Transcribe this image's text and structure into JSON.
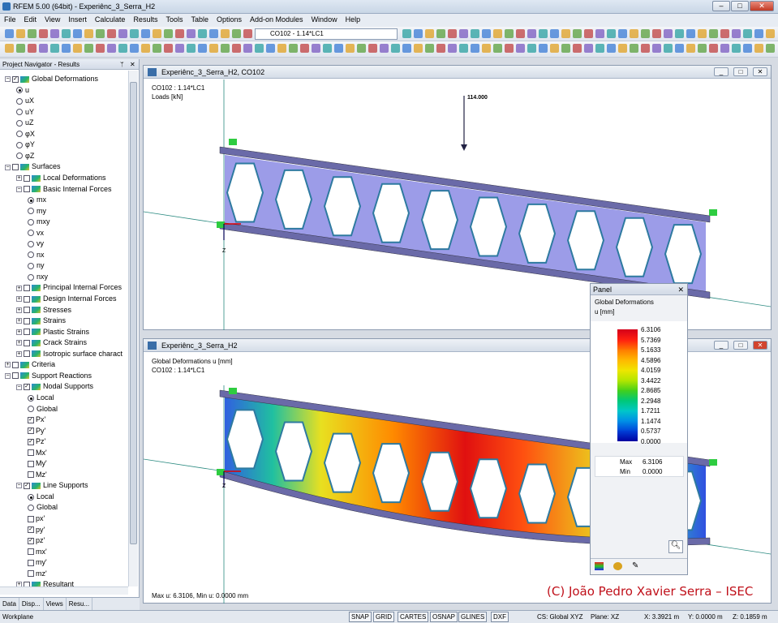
{
  "window": {
    "title": "RFEM 5.00 (64bit) - Experiênc_3_Serra_H2"
  },
  "menu": [
    "File",
    "Edit",
    "View",
    "Insert",
    "Calculate",
    "Results",
    "Tools",
    "Table",
    "Options",
    "Add-on Modules",
    "Window",
    "Help"
  ],
  "toolbar": {
    "load_combo": "CO102 - 1.14*LC1"
  },
  "navigator": {
    "title": "Project Navigator - Results",
    "items": [
      {
        "label": "Global Deformations",
        "level": 1,
        "kind": "folder-check"
      },
      {
        "label": "u",
        "level": 2,
        "kind": "radio",
        "on": true
      },
      {
        "label": "uX",
        "level": 2,
        "kind": "radio"
      },
      {
        "label": "uY",
        "level": 2,
        "kind": "radio"
      },
      {
        "label": "uZ",
        "level": 2,
        "kind": "radio"
      },
      {
        "label": "φX",
        "level": 2,
        "kind": "radio"
      },
      {
        "label": "φY",
        "level": 2,
        "kind": "radio"
      },
      {
        "label": "φZ",
        "level": 2,
        "kind": "radio"
      },
      {
        "label": "Surfaces",
        "level": 1,
        "kind": "folder-check"
      },
      {
        "label": "Local Deformations",
        "level": 2,
        "kind": "folder-check"
      },
      {
        "label": "Basic Internal Forces",
        "level": 2,
        "kind": "folder-check"
      },
      {
        "label": "mx",
        "level": 3,
        "kind": "radio",
        "on": true
      },
      {
        "label": "my",
        "level": 3,
        "kind": "radio"
      },
      {
        "label": "mxy",
        "level": 3,
        "kind": "radio"
      },
      {
        "label": "vx",
        "level": 3,
        "kind": "radio"
      },
      {
        "label": "vy",
        "level": 3,
        "kind": "radio"
      },
      {
        "label": "nx",
        "level": 3,
        "kind": "radio"
      },
      {
        "label": "ny",
        "level": 3,
        "kind": "radio"
      },
      {
        "label": "nxy",
        "level": 3,
        "kind": "radio"
      },
      {
        "label": "Principal Internal Forces",
        "level": 2,
        "kind": "folder-check"
      },
      {
        "label": "Design Internal Forces",
        "level": 2,
        "kind": "folder-check"
      },
      {
        "label": "Stresses",
        "level": 2,
        "kind": "folder-check"
      },
      {
        "label": "Strains",
        "level": 2,
        "kind": "folder-check"
      },
      {
        "label": "Plastic Strains",
        "level": 2,
        "kind": "folder-check"
      },
      {
        "label": "Crack Strains",
        "level": 2,
        "kind": "folder-check"
      },
      {
        "label": "Isotropic surface charact",
        "level": 2,
        "kind": "folder-check"
      },
      {
        "label": "Criteria",
        "level": 1,
        "kind": "folder-check"
      },
      {
        "label": "Support Reactions",
        "level": 1,
        "kind": "folder-check"
      },
      {
        "label": "Nodal Supports",
        "level": 2,
        "kind": "folder-check"
      },
      {
        "label": "Local",
        "level": 3,
        "kind": "radio",
        "on": true
      },
      {
        "label": "Global",
        "level": 3,
        "kind": "radio"
      },
      {
        "label": "Px'",
        "level": 3,
        "kind": "check",
        "on": true
      },
      {
        "label": "Py'",
        "level": 3,
        "kind": "check",
        "on": true
      },
      {
        "label": "Pz'",
        "level": 3,
        "kind": "check",
        "on": true
      },
      {
        "label": "Mx'",
        "level": 3,
        "kind": "check"
      },
      {
        "label": "My'",
        "level": 3,
        "kind": "check"
      },
      {
        "label": "Mz'",
        "level": 3,
        "kind": "check"
      },
      {
        "label": "Line Supports",
        "level": 2,
        "kind": "folder-check"
      },
      {
        "label": "Local",
        "level": 3,
        "kind": "radio",
        "on": true
      },
      {
        "label": "Global",
        "level": 3,
        "kind": "radio"
      },
      {
        "label": "px'",
        "level": 3,
        "kind": "check"
      },
      {
        "label": "py'",
        "level": 3,
        "kind": "check",
        "on": true
      },
      {
        "label": "pz'",
        "level": 3,
        "kind": "check",
        "on": true
      },
      {
        "label": "mx'",
        "level": 3,
        "kind": "check"
      },
      {
        "label": "my'",
        "level": 3,
        "kind": "check"
      },
      {
        "label": "mz'",
        "level": 3,
        "kind": "check"
      },
      {
        "label": "Resultant",
        "level": 2,
        "kind": "folder-check"
      }
    ],
    "tabs": [
      "Data",
      "Disp...",
      "Views",
      "Resu..."
    ]
  },
  "view1": {
    "title": "Experiênc_3_Serra_H2, CO102",
    "info1": "CO102 : 1.14*LC1",
    "info2": "Loads [kN]",
    "load_value": "114.000",
    "axis_z": "Z"
  },
  "view2": {
    "title": "Experiênc_3_Serra_H2",
    "info1": "Global Deformations u [mm]",
    "info2": "CO102 : 1.14*LC1",
    "footer": "Max u: 6.3106, Min u: 0.0000 mm",
    "axis_z": "Z"
  },
  "panel": {
    "title": "Panel",
    "heading": "Global Deformations",
    "unit": "u [mm]",
    "legend_values": [
      "6.3106",
      "5.7369",
      "5.1633",
      "4.5896",
      "4.0159",
      "3.4422",
      "2.8685",
      "2.2948",
      "1.7211",
      "1.1474",
      "0.5737",
      "0.0000"
    ],
    "legend_colors": [
      "#d4001a",
      "#ff2010",
      "#ff7a00",
      "#ffb800",
      "#f0e600",
      "#b4e600",
      "#44d01a",
      "#00c878",
      "#00c8c8",
      "#0090e6",
      "#0040d8",
      "#0000a0"
    ],
    "max_label": "Max",
    "max_value": "6.3106",
    "min_label": "Min",
    "min_value": "0.0000"
  },
  "watermark": "(C) João Pedro Xavier Serra – ISEC",
  "status": {
    "left": "Workplane",
    "buttons": [
      "SNAP",
      "GRID",
      "CARTES",
      "OSNAP",
      "GLINES",
      "DXF"
    ],
    "cs": "CS: Global XYZ",
    "plane": "Plane: XZ",
    "x": "X: 3.3921 m",
    "y": "Y: 0.0000 m",
    "z": "Z: 0.1859 m"
  }
}
